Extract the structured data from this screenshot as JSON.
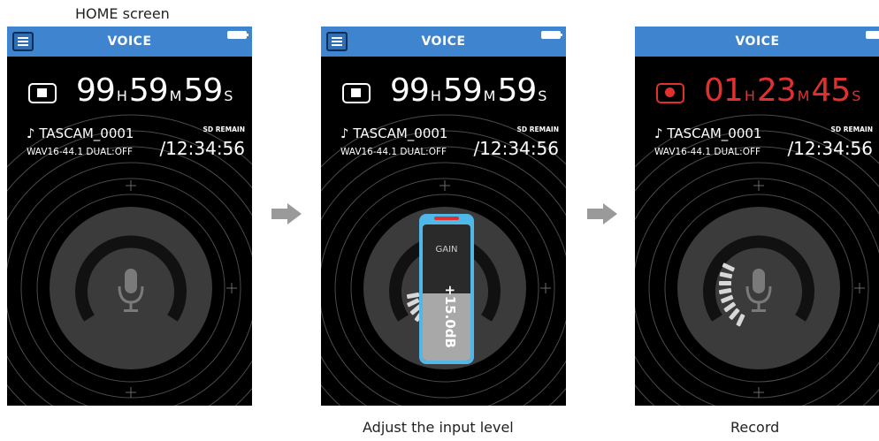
{
  "captions": {
    "home": "HOME screen",
    "adjust": "Adjust the input level",
    "record": "Record"
  },
  "screens": [
    {
      "title": "VOICE",
      "has_menu": true,
      "state": "stop",
      "counter": {
        "h": "99",
        "h_unit": "H",
        "m": "59",
        "m_unit": "M",
        "s": "59",
        "s_unit": "S"
      },
      "filename": "♪ TASCAM_0001",
      "format": "WAV16-44.1 DUAL:OFF",
      "sd_label": "SD REMAIN",
      "sd_time": "/12:34:56"
    },
    {
      "title": "VOICE",
      "has_menu": true,
      "state": "stop",
      "counter": {
        "h": "99",
        "h_unit": "H",
        "m": "59",
        "m_unit": "M",
        "s": "59",
        "s_unit": "S"
      },
      "filename": "♪ TASCAM_0001",
      "format": "WAV16-44.1 DUAL:OFF",
      "sd_label": "SD REMAIN",
      "sd_time": "/12:34:56",
      "gain": {
        "label": "GAIN",
        "value": "+15.0dB",
        "level": 0.5
      }
    },
    {
      "title": "VOICE",
      "has_menu": false,
      "state": "record",
      "counter": {
        "h": "01",
        "h_unit": "H",
        "m": "23",
        "m_unit": "M",
        "s": "45",
        "s_unit": "S"
      },
      "filename": "♪ TASCAM_0001",
      "format": "WAV16-44.1 DUAL:OFF",
      "sd_label": "SD REMAIN",
      "sd_time": "/12:34:56"
    }
  ],
  "colors": {
    "topbar": "#3f84cf",
    "record_red": "#e03030",
    "gain_frame": "#4fb8e8"
  },
  "icons": {
    "menu": "menu-icon",
    "battery": "battery-icon",
    "mic": "microphone-icon",
    "arrow": "arrow-right-icon"
  }
}
